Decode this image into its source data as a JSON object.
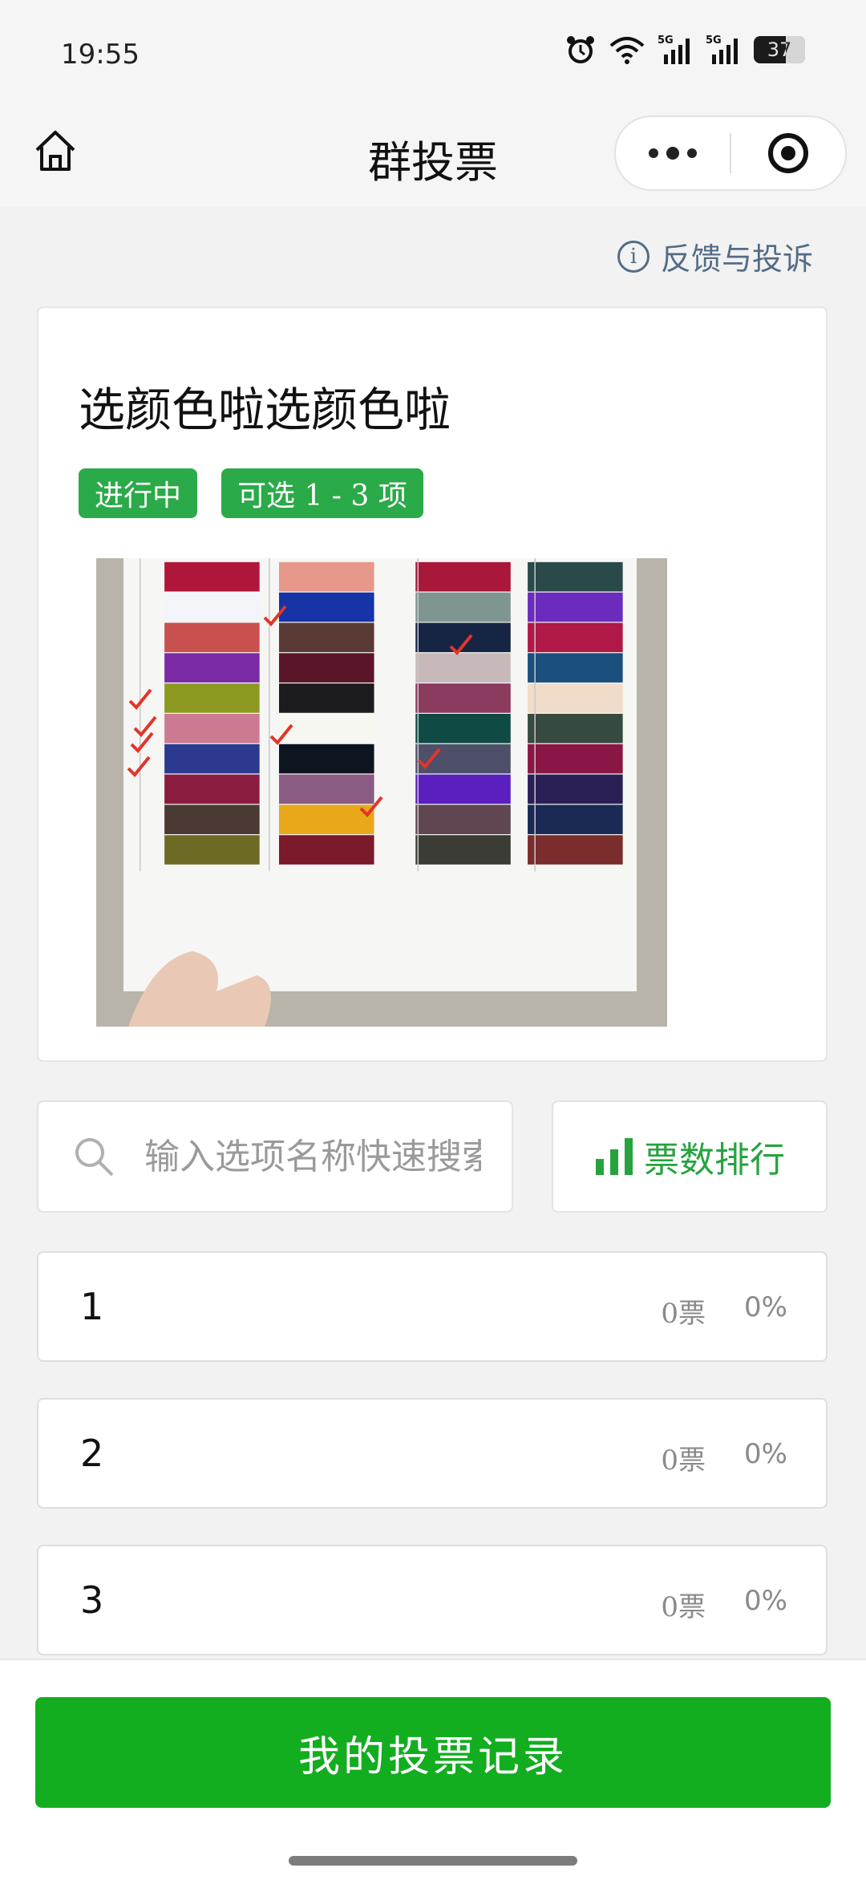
{
  "status_bar": {
    "time": "19:55",
    "battery": "37",
    "network_1": "5G",
    "network_2": "5G"
  },
  "nav": {
    "title": "群投票"
  },
  "feedback": {
    "label": "反馈与投诉"
  },
  "poll": {
    "title": "选颜色啦选颜色啦",
    "status_tag": "进行中",
    "choice_tag": "可选 1 - 3 项"
  },
  "search": {
    "placeholder": "输入选项名称快速搜索"
  },
  "rank_button": {
    "label": "票数排行"
  },
  "options": [
    {
      "name": "1",
      "votes": "0票",
      "percent": "0%"
    },
    {
      "name": "2",
      "votes": "0票",
      "percent": "0%"
    },
    {
      "name": "3",
      "votes": "0票",
      "percent": "0%"
    }
  ],
  "bottom": {
    "record_button": "我的投票记录"
  },
  "colors": {
    "accent": "#13ad20",
    "tag_green": "#2aaa48",
    "link_blue": "#546c86"
  },
  "icons": [
    "home-icon",
    "more-icon",
    "target-icon",
    "info-icon",
    "search-icon",
    "bar-chart-icon"
  ]
}
